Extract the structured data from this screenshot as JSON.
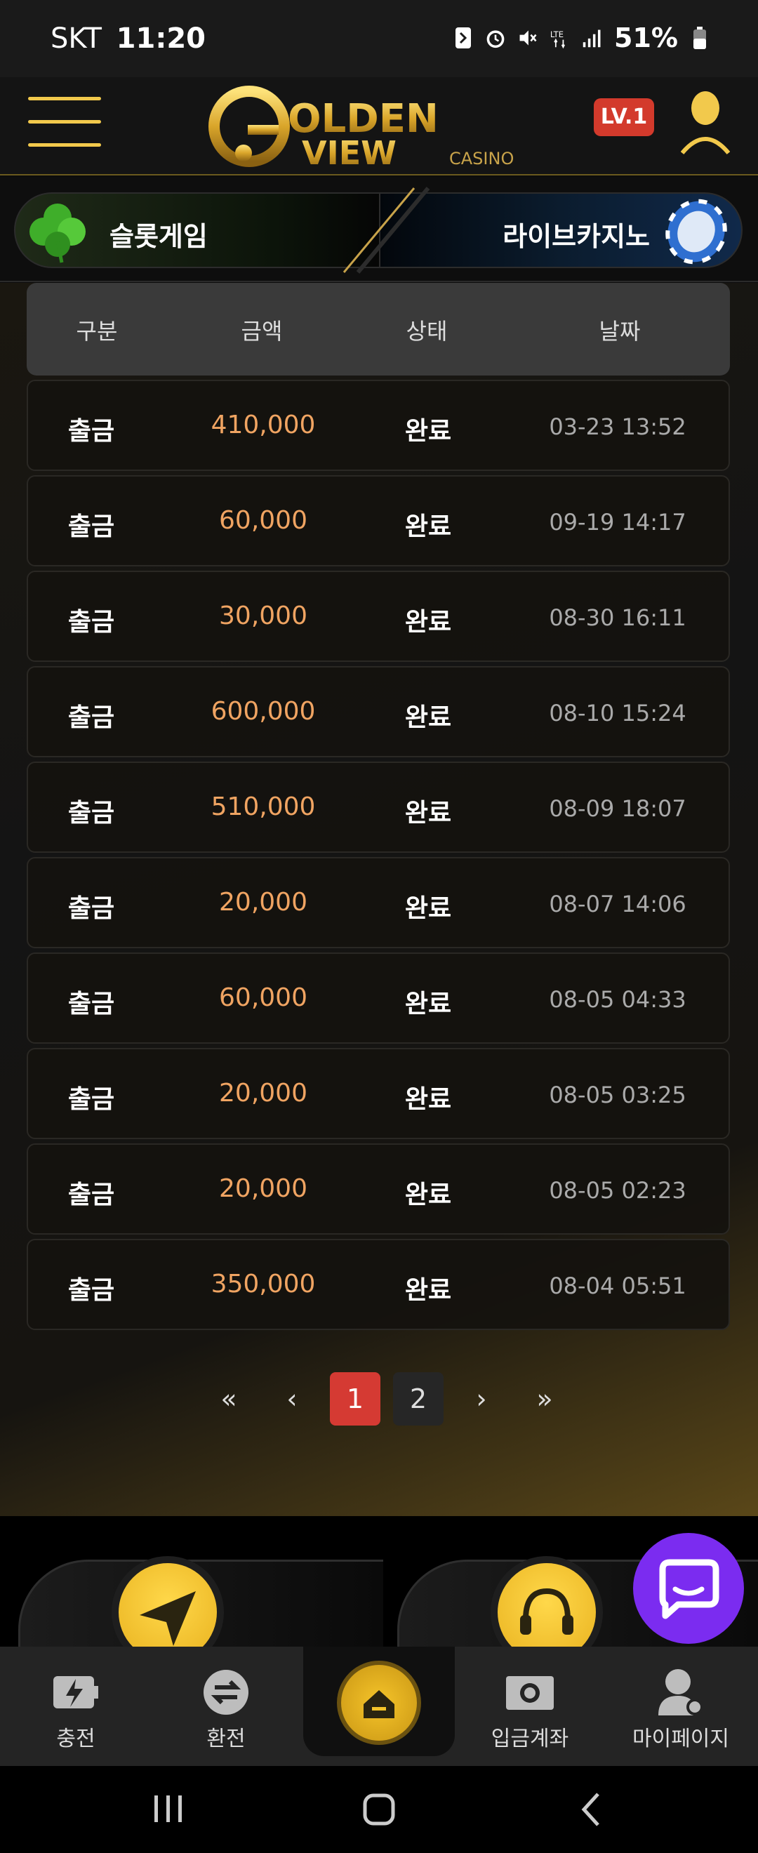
{
  "status_bar": {
    "carrier": "SKT",
    "time": "11:20",
    "battery": "51%"
  },
  "header": {
    "logo_text_main": "OLDEN",
    "logo_text_view": "VIEW",
    "logo_text_casino": "CASINO",
    "level_badge": "LV.1"
  },
  "game_tabs": {
    "slot_label": "슬롯게임",
    "live_label": "라이브카지노"
  },
  "table": {
    "headers": [
      "구분",
      "금액",
      "상태",
      "날짜"
    ],
    "rows": [
      {
        "type": "출금",
        "amount": "410,000",
        "status": "완료",
        "date": "03-23 13:52"
      },
      {
        "type": "출금",
        "amount": "60,000",
        "status": "완료",
        "date": "09-19 14:17"
      },
      {
        "type": "출금",
        "amount": "30,000",
        "status": "완료",
        "date": "08-30 16:11"
      },
      {
        "type": "출금",
        "amount": "600,000",
        "status": "완료",
        "date": "08-10 15:24"
      },
      {
        "type": "출금",
        "amount": "510,000",
        "status": "완료",
        "date": "08-09 18:07"
      },
      {
        "type": "출금",
        "amount": "20,000",
        "status": "완료",
        "date": "08-07 14:06"
      },
      {
        "type": "출금",
        "amount": "60,000",
        "status": "완료",
        "date": "08-05 04:33"
      },
      {
        "type": "출금",
        "amount": "20,000",
        "status": "완료",
        "date": "08-05 03:25"
      },
      {
        "type": "출금",
        "amount": "20,000",
        "status": "완료",
        "date": "08-05 02:23"
      },
      {
        "type": "출금",
        "amount": "350,000",
        "status": "완료",
        "date": "08-04 05:51"
      }
    ]
  },
  "pagination": {
    "first": "«",
    "prev": "‹",
    "pages": [
      "1",
      "2"
    ],
    "current": "1",
    "next": "›",
    "last": "»"
  },
  "bottom_nav": {
    "charge": "충전",
    "exchange": "환전",
    "deposit_account": "입금계좌",
    "my_page": "마이페이지"
  },
  "colors": {
    "accent_gold": "#f2c94c",
    "amount_orange": "#f0a462",
    "active_page": "#d53a33",
    "level_badge": "#d33a2c",
    "chat_purple": "#7b2cf0"
  },
  "icons": [
    "menu-icon",
    "user-icon",
    "clover-icon",
    "casino-chip-icon",
    "send-icon",
    "headset-icon",
    "chat-icon",
    "charge-icon",
    "exchange-icon",
    "home-icon",
    "camera-icon",
    "my-page-icon"
  ]
}
